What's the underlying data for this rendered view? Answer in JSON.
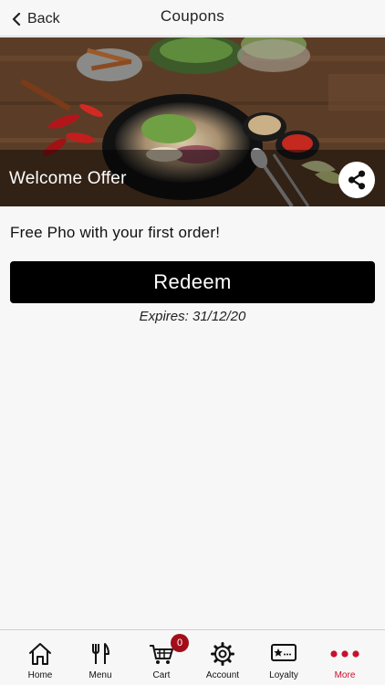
{
  "header": {
    "back_label": "Back",
    "title": "Coupons"
  },
  "coupon": {
    "name": "Welcome Offer",
    "description": "Free Pho with your first order!",
    "redeem_label": "Redeem",
    "expires": "Expires: 31/12/20"
  },
  "tabbar": {
    "items": [
      {
        "label": "Home",
        "icon": "home-icon"
      },
      {
        "label": "Menu",
        "icon": "fork-knife-icon"
      },
      {
        "label": "Cart",
        "icon": "cart-icon"
      },
      {
        "label": "Account",
        "icon": "gear-icon"
      },
      {
        "label": "Loyalty",
        "icon": "loyalty-card-icon"
      },
      {
        "label": "More",
        "icon": "more-dots-icon"
      }
    ],
    "cart_count": "0",
    "active": "More"
  },
  "colors": {
    "accent": "#c8102e",
    "badge": "#a10e1a",
    "button_bg": "#000000"
  }
}
